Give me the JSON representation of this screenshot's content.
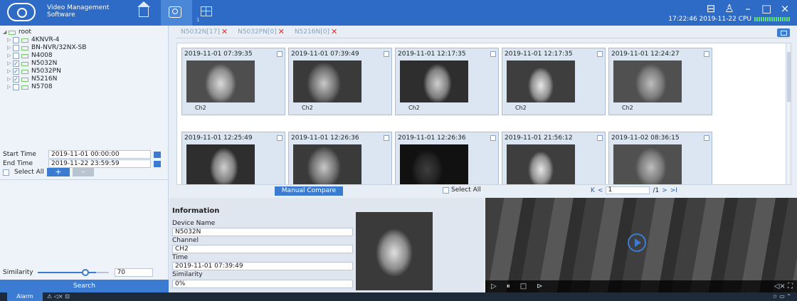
{
  "app": {
    "title": "Video Management Software",
    "clock": "17:22:46 2019-11-22 CPU",
    "tab_badge": "1"
  },
  "tree": {
    "root": "root",
    "devices": [
      {
        "name": "4KNVR-4",
        "checked": false
      },
      {
        "name": "BN-NVR/32NX-SB",
        "checked": false
      },
      {
        "name": "N4008",
        "checked": false
      },
      {
        "name": "N5032N",
        "checked": true
      },
      {
        "name": "N5032PN",
        "checked": true
      },
      {
        "name": "N5216N",
        "checked": true
      },
      {
        "name": "N5708",
        "checked": false
      }
    ]
  },
  "filter": {
    "start_label": "Start Time",
    "start_value": "2019-11-01 00:00:00",
    "end_label": "End Time",
    "end_value": "2019-11-22 23:59:59",
    "select_all": "Select All",
    "plus": "+",
    "minus": "–",
    "similarity_label": "Similarity",
    "similarity_value": "70",
    "search": "Search"
  },
  "camera_tabs": [
    "N5032N[17]",
    "N5032PN[0]",
    "N5216N[0]"
  ],
  "results": [
    {
      "ts": "2019-11-01 07:39:35",
      "ch": "Ch2"
    },
    {
      "ts": "2019-11-01 07:39:49",
      "ch": "Ch2"
    },
    {
      "ts": "2019-11-01 12:17:35",
      "ch": "Ch2"
    },
    {
      "ts": "2019-11-01 12:17:35",
      "ch": "Ch2"
    },
    {
      "ts": "2019-11-01 12:24:27",
      "ch": "Ch2"
    },
    {
      "ts": "2019-11-01 12:25:49",
      "ch": ""
    },
    {
      "ts": "2019-11-01 12:26:36",
      "ch": ""
    },
    {
      "ts": "2019-11-01 12:26:36",
      "ch": ""
    },
    {
      "ts": "2019-11-01 21:56:12",
      "ch": ""
    },
    {
      "ts": "2019-11-02 08:36:15",
      "ch": ""
    }
  ],
  "toolbar": {
    "manual_compare": "Manual Compare",
    "select_all": "Select All",
    "page_input": "1",
    "page_total": "/1",
    "first": "K",
    "prev": "<",
    "next": ">",
    "last": ">I"
  },
  "info": {
    "title": "Information",
    "device_label": "Device Name",
    "device_value": "N5032N",
    "channel_label": "Channel",
    "channel_value": "CH2",
    "time_label": "Time",
    "time_value": "2019-11-01 07:39:49",
    "similarity_label": "Similarity",
    "similarity_value": "0%"
  },
  "statusbar": {
    "alarm": "Alarm"
  }
}
